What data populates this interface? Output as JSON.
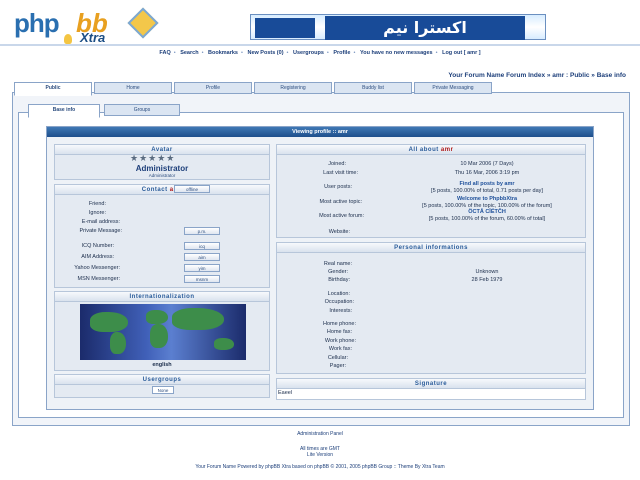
{
  "header": {
    "logo_php": "php",
    "logo_bb": "bb",
    "logo_xtra": "Xtra",
    "banner_text": "اكسترا نيم"
  },
  "topnav": [
    "FAQ",
    "Search",
    "Bookmarks",
    "New Posts (0)",
    "Usergroups",
    "Profile",
    "You have no new messages",
    "Log out [ amr ]"
  ],
  "breadcrumb": "Your Forum Name Forum Index  »  amr : Public  »  Base info",
  "tabs1": [
    "Public",
    "Home",
    "Profile",
    "Registering",
    "Buddy list",
    "Private Messaging"
  ],
  "tabs2": [
    "Base info",
    "Groups"
  ],
  "content_title": "Viewing profile :: amr",
  "avatar": {
    "title": "Avatar",
    "stars": "★★★★★",
    "rank": "Administrator",
    "rank_sub": "Administrator"
  },
  "contact": {
    "title_prefix": "Contact",
    "title_user": "amr",
    "online_btn": "offline",
    "rows": [
      {
        "label": "Friend:",
        "button": ""
      },
      {
        "label": "Ignore:",
        "button": ""
      },
      {
        "label": "E-mail address:",
        "button": ""
      },
      {
        "label": "Private Message:",
        "button": "p.m."
      },
      {
        "label": "ICQ Number:",
        "button": "icq"
      },
      {
        "label": "AIM Address:",
        "button": "aim"
      },
      {
        "label": "Yahoo Messenger:",
        "button": "yim"
      },
      {
        "label": "MSN Messenger:",
        "button": "msnm"
      }
    ]
  },
  "intl": {
    "title": "Internationalization",
    "language": "english"
  },
  "usergroups": {
    "title": "Usergroups",
    "value": "None"
  },
  "about": {
    "title_prefix": "All about",
    "title_user": "amr",
    "joined_label": "Joined:",
    "joined_value": "10 Mar 2006 (7 Days)",
    "lastvisit_label": "Last visit time:",
    "lastvisit_value": "Thu 16 Mar, 2006 3:19 pm",
    "posts_label": "User posts:",
    "posts_link": "Find all posts by amr",
    "posts_value": "[5 posts, 100.00% of total, 0.71 posts per day]",
    "topic_label": "Most active topic:",
    "topic_link": "Welcome to PhpbbXtra",
    "topic_value": "[5 posts, 100.00% of the topic, 100.00% of the forum]",
    "forum_label": "Most active forum:",
    "forum_link": "ÖCTÅ CÏЁТČН",
    "forum_value": "[5 posts, 100.00% of the forum, 60.00% of total]",
    "website_label": "Website:"
  },
  "personal": {
    "title": "Personal informations",
    "rows": [
      {
        "label": "Real name:",
        "value": ""
      },
      {
        "label": "Gender:",
        "value": "Unknown"
      },
      {
        "label": "Birthday:",
        "value": "28 Feb 1979"
      },
      {
        "label": "Location:",
        "value": ""
      },
      {
        "label": "Occupation:",
        "value": ""
      },
      {
        "label": "Interests:",
        "value": ""
      },
      {
        "label": "Home phone:",
        "value": ""
      },
      {
        "label": "Home fax:",
        "value": ""
      },
      {
        "label": "Work phone:",
        "value": ""
      },
      {
        "label": "Work fax:",
        "value": ""
      },
      {
        "label": "Cellular:",
        "value": ""
      },
      {
        "label": "Pager:",
        "value": ""
      }
    ]
  },
  "signature": {
    "title": "Signature",
    "value": "Eaeel"
  },
  "footer": {
    "admin_panel": "Administration Panel",
    "timezone": "All times are GMT",
    "lite": "Lite Version",
    "credits": "Your Forum Name   Powered by phpBB Xtra based on phpBB © 2001, 2005 phpBB Group :: Theme By Xtra Team"
  }
}
